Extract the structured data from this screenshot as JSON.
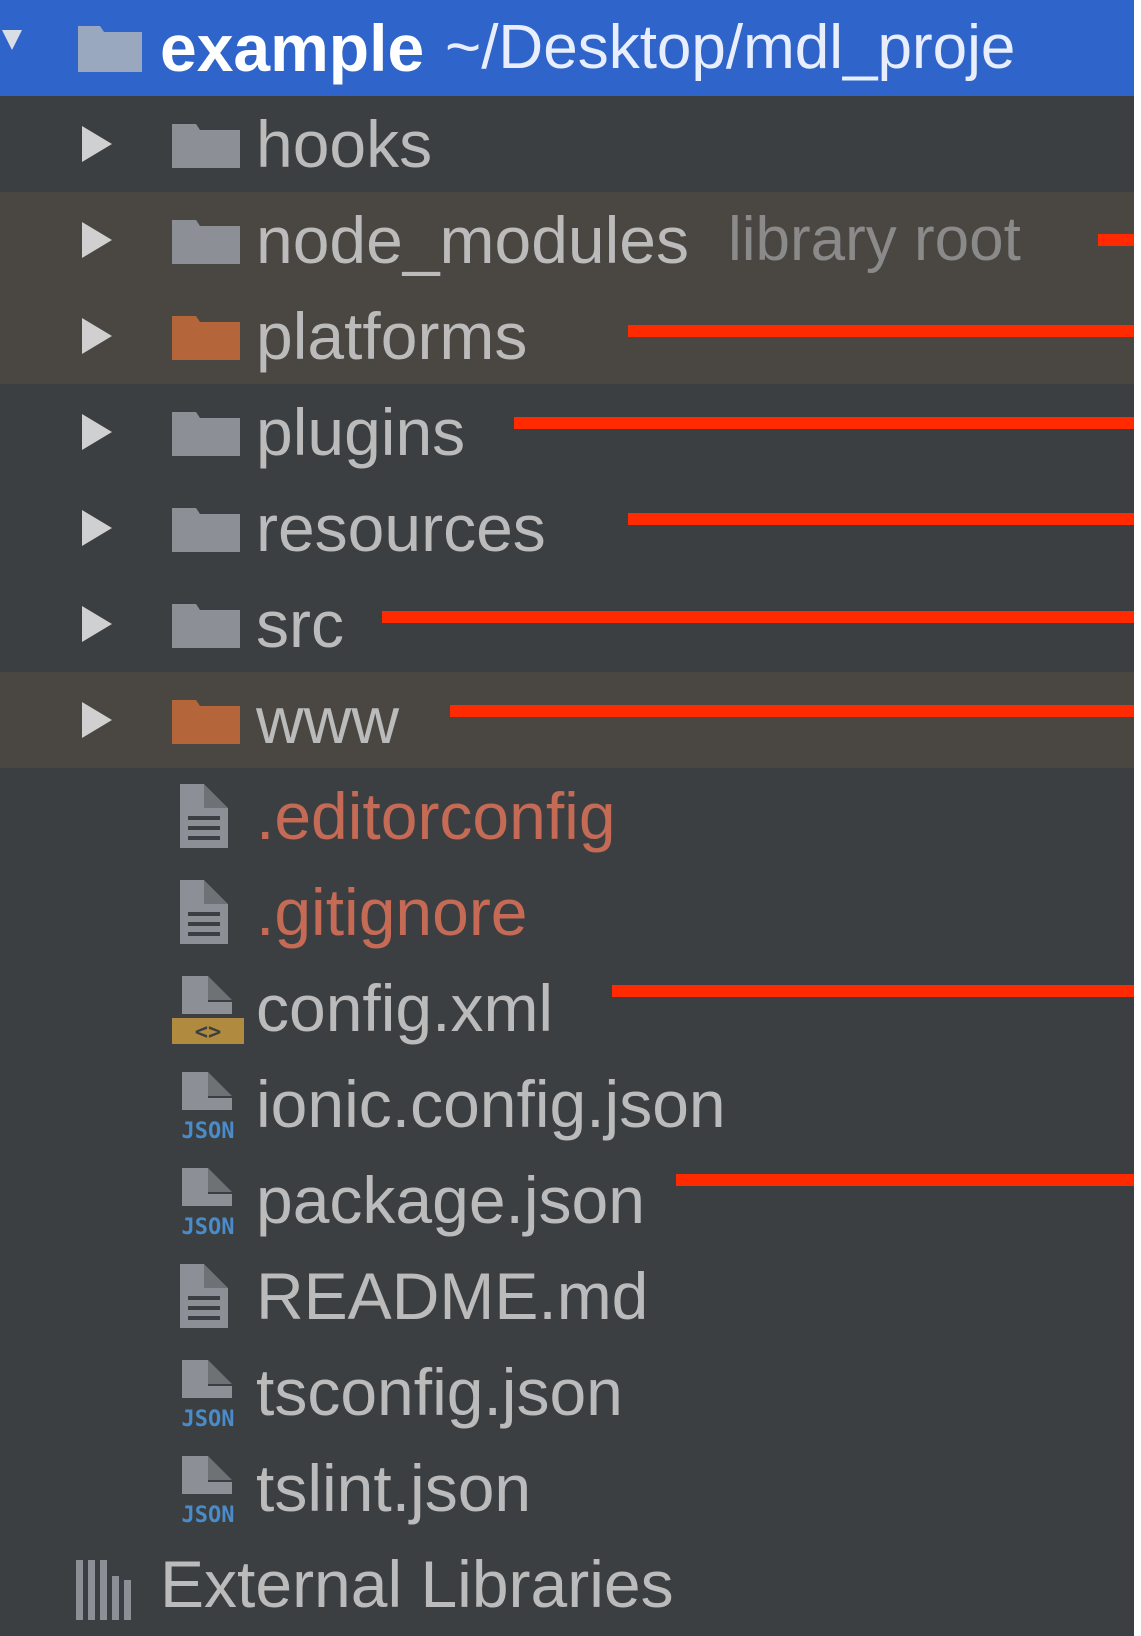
{
  "project": {
    "name": "example",
    "path": "~/Desktop/mdl_proje"
  },
  "folders": [
    {
      "name": "hooks",
      "kind": "normal"
    },
    {
      "name": "node_modules",
      "kind": "normal",
      "hint": "library root"
    },
    {
      "name": "platforms",
      "kind": "excluded"
    },
    {
      "name": "plugins",
      "kind": "normal"
    },
    {
      "name": "resources",
      "kind": "normal"
    },
    {
      "name": "src",
      "kind": "normal"
    },
    {
      "name": "www",
      "kind": "excluded"
    }
  ],
  "files": [
    {
      "name": ".editorconfig",
      "icon": "text-file-icon",
      "status": "ignored"
    },
    {
      "name": ".gitignore",
      "icon": "text-file-icon",
      "status": "ignored"
    },
    {
      "name": "config.xml",
      "icon": "xml-file-icon",
      "status": "normal",
      "badge": "<>"
    },
    {
      "name": "ionic.config.json",
      "icon": "json-file-icon",
      "status": "normal",
      "badge": "JSON"
    },
    {
      "name": "package.json",
      "icon": "json-file-icon",
      "status": "normal",
      "badge": "JSON"
    },
    {
      "name": "README.md",
      "icon": "text-file-icon",
      "status": "normal"
    },
    {
      "name": "tsconfig.json",
      "icon": "json-file-icon",
      "status": "normal",
      "badge": "JSON"
    },
    {
      "name": "tslint.json",
      "icon": "json-file-icon",
      "status": "normal",
      "badge": "JSON"
    }
  ],
  "external": {
    "label": "External Libraries",
    "icon": "library-icon"
  },
  "colors": {
    "panel_bg": "#3c3f41",
    "selection": "#2f65ca",
    "excluded_row": "#4a4642",
    "excluded_folder": "#b5653a",
    "normal_folder": "#8c9096",
    "ignored_text": "#c46a55",
    "annotation": "#ff2a00"
  },
  "annotations": {
    "marked_items": [
      "node_modules",
      "platforms",
      "plugins",
      "resources",
      "src",
      "www",
      "config.xml",
      "package.json"
    ]
  }
}
